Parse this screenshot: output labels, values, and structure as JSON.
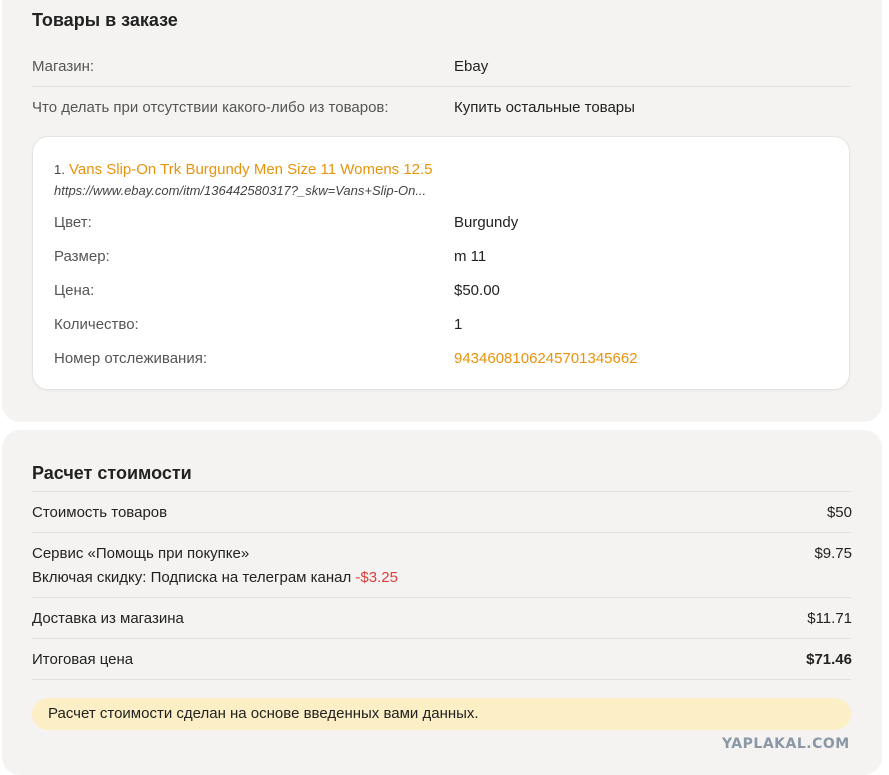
{
  "order": {
    "title": "Товары в заказе",
    "store_label": "Магазин:",
    "store_value": "Ebay",
    "missing_label": "Что делать при отсутствии какого-либо из товаров:",
    "missing_value": "Купить остальные товары",
    "item": {
      "number": "1.",
      "name": "Vans Slip-On Trk Burgundy Men Size 11 Womens 12.5",
      "url": "https://www.ebay.com/itm/136442580317?_skw=Vans+Slip-On...",
      "color_label": "Цвет:",
      "color_value": "Burgundy",
      "size_label": "Размер:",
      "size_value": "m 11",
      "price_label": "Цена:",
      "price_value": "$50.00",
      "qty_label": "Количество:",
      "qty_value": "1",
      "tracking_label": "Номер отслеживания:",
      "tracking_value": "9434608106245701345662"
    }
  },
  "cost": {
    "title": "Расчет стоимости",
    "goods_label": "Стоимость товаров",
    "goods_value": "$50",
    "service_label": "Сервис «Помощь при покупке»",
    "service_value": "$9.75",
    "discount_label": "Включая скидку: Подписка на телеграм канал",
    "discount_value": "-$3.25",
    "delivery_label": "Доставка из магазина",
    "delivery_value": "$11.71",
    "total_label": "Итоговая цена",
    "total_value": "$71.46",
    "note": "Расчет стоимости сделан на основе введенных вами данных."
  },
  "watermark": "YAPLAKAL.COM",
  "colors": {
    "accent": "#e8930c",
    "card_bg": "#f4f3f1",
    "negative": "#d93f3f",
    "note_bg": "#fcefc6"
  }
}
